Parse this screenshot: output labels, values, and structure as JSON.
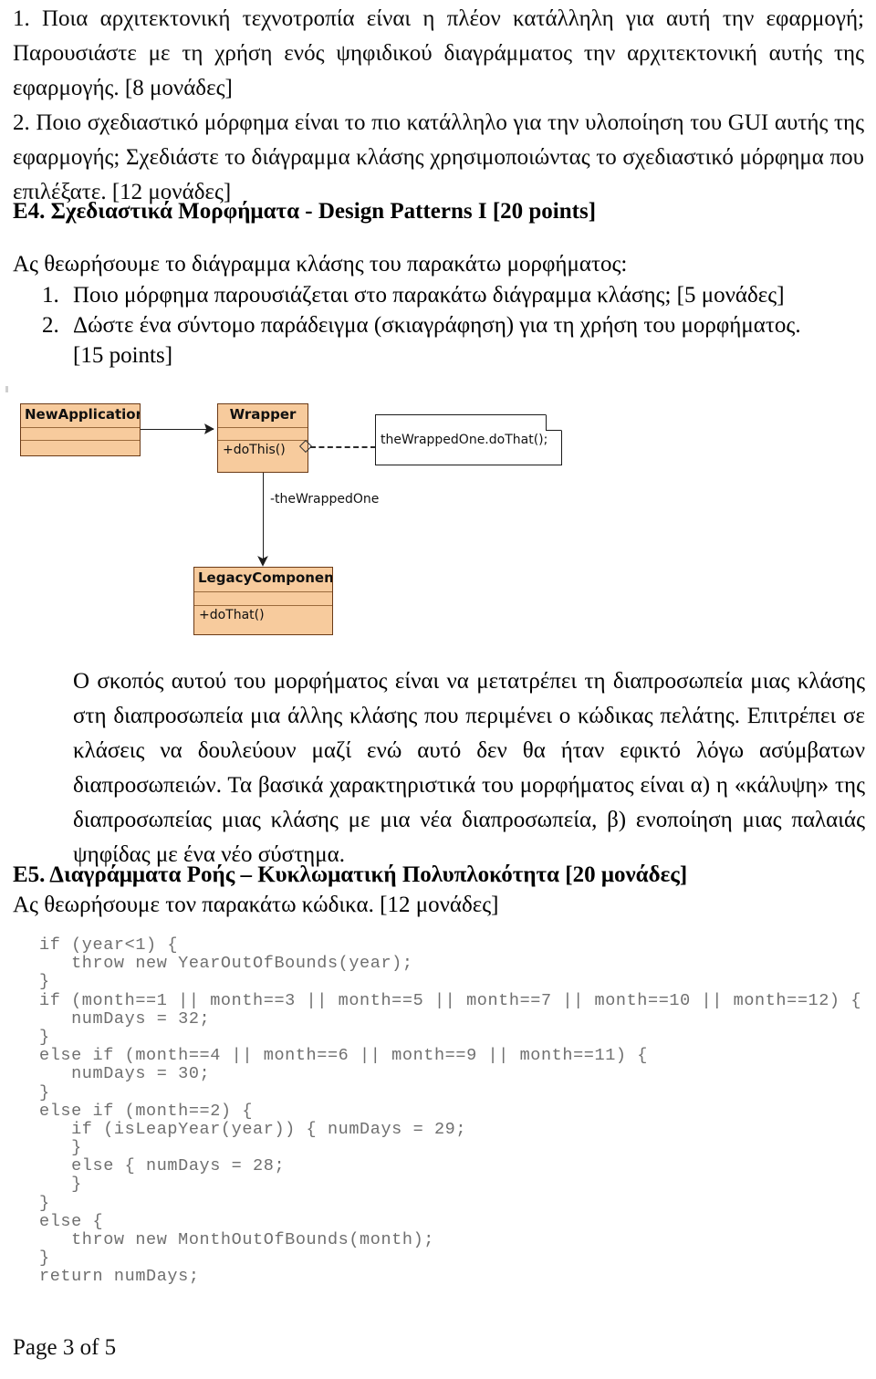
{
  "top_questions": {
    "item1_marker": "1.",
    "item1_text": "Ποια αρχιτεκτονική τεχνοτροπία είναι η πλέον κατάλληλη για αυτή την εφαρμογή; Παρουσιάστε με τη χρήση ενός ψηφιδικού διαγράμματος την αρχιτεκτονική αυτής της εφαρμογής. [8 μονάδες]",
    "item2_marker": "2.",
    "item2_text": "Ποιο σχεδιαστικό μόρφημα είναι το πιο κατάλληλο για την υλοποίηση του GUI αυτής της εφαρμογής; Σχεδιάστε το διάγραμμα κλάσης χρησιμοποιώντας το σχεδιαστικό μόρφημα που επιλέξατε. [12 μονάδες]"
  },
  "section_e4": {
    "heading": "Ε4. Σχεδιαστικά Μορφήματα - Design Patterns I [20 points]",
    "intro": "Ας θεωρήσουμε το διάγραμμα κλάσης του παρακάτω μορφήματος:",
    "items": [
      {
        "index": "1.",
        "text": "Ποιο μόρφημα  παρουσιάζεται στο παρακάτω διάγραμμα κλάσης; [5 μονάδες]"
      },
      {
        "index": "2.",
        "text": "Δώστε ένα σύντομο παράδειγμα (σκιαγράφηση) για τη χρήση του μορφήματος.",
        "continuation": "[15 points]"
      }
    ],
    "explanation": "Ο σκοπός αυτού του μορφήματος είναι να μετατρέπει τη διαπροσωπεία μιας κλάσης στη διαπροσωπεία μια άλλης κλάσης που περιμένει ο κώδικας πελάτης. Επιτρέπει σε κλάσεις να δουλεύουν μαζί ενώ αυτό δεν θα ήταν εφικτό λόγω ασύμβατων διαπροσωπειών. Τα βασικά χαρακτηριστικά του μορφήματος είναι α) η «κάλυψη» της διαπροσωπείας μιας κλάσης με μια νέα διαπροσωπεία, β) ενοποίηση μιας παλαιάς ψηφίδας με ένα νέο σύστημα."
  },
  "uml_diagram": {
    "class_fill_color": "#f7cb9d",
    "class_border_color": "#6b3a16",
    "classes": [
      {
        "name": "NewApplication",
        "operation": ""
      },
      {
        "name": "Wrapper",
        "operation": "+doThis()"
      },
      {
        "name": "LegacyComponent",
        "operation": "+doThat()"
      }
    ],
    "note_text": "theWrappedOne.doThat();",
    "association_label": "-theWrappedOne"
  },
  "section_e5": {
    "heading": "Ε5. Διαγράμματα Ροής – Κυκλωματική Πολυπλοκότητα [20 μονάδες]",
    "intro": "Ας θεωρήσουμε τον παρακάτω κώδικα. [12 μονάδες]",
    "code_lines": [
      "if (year<1) {",
      "   throw new YearOutOfBounds(year);",
      "}",
      "if (month==1 || month==3 || month==5 || month==7 || month==10 || month==12) {",
      "   numDays = 32;",
      "}",
      "else if (month==4 || month==6 || month==9 || month==11) {",
      "   numDays = 30;",
      "}",
      "else if (month==2) {",
      "   if (isLeapYear(year)) { numDays = 29;",
      "   }",
      "   else { numDays = 28;",
      "   }",
      "}",
      "else {",
      "   throw new MonthOutOfBounds(month);",
      "}",
      "return numDays;"
    ]
  },
  "footer": {
    "page_label": "Page 3 of 5"
  }
}
